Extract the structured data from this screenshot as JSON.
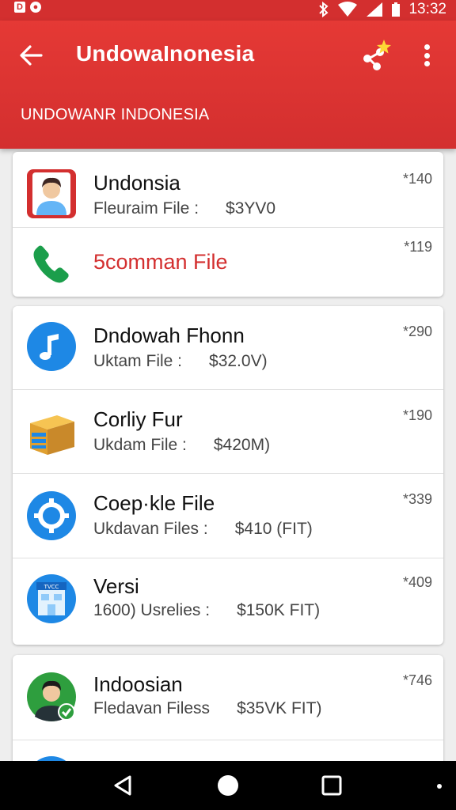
{
  "status_bar": {
    "time": "13:32"
  },
  "app_bar": {
    "title": "UndowaInonesia",
    "subtitle": "UNDOWANR INDONESIA"
  },
  "cards": [
    {
      "rows": [
        {
          "icon": "person-avatar-icon",
          "title": "Undonsia",
          "sub_label": "Fleuraim File :",
          "sub_value": "$3YV0",
          "price": "*140"
        },
        {
          "icon": "phone-icon",
          "title": "5comman File",
          "sub_label": "",
          "sub_value": "",
          "price": "*119",
          "accent": "#d32f2f"
        }
      ]
    },
    {
      "rows": [
        {
          "icon": "music-note-icon",
          "title": "Dndowah Fhonn",
          "sub_label": "Uktam File :",
          "sub_value": "$32.0V)",
          "price": "*290"
        },
        {
          "icon": "package-box-icon",
          "title": "Corliy Fur",
          "sub_label": "Ukdam File :",
          "sub_value": "$420M)",
          "price": "*190"
        },
        {
          "icon": "settings-gear-icon",
          "title": "Coep·kle File",
          "sub_label": "Ukdavan Files :",
          "sub_value": "$410 (FIT)",
          "price": "*339"
        },
        {
          "icon": "store-building-icon",
          "title": "Versi",
          "sub_label": "1600) Usrelies :",
          "sub_value": "$150K FIT)",
          "price": "*409"
        }
      ]
    },
    {
      "rows": [
        {
          "icon": "verified-user-avatar-icon",
          "title": "Indoosian",
          "sub_label": "Fledavan Filess",
          "sub_value": "$35VK FIT)",
          "price": "*746"
        }
      ]
    }
  ],
  "colors": {
    "primary": "#d32f2f",
    "blue": "#1e88e5",
    "green": "#2e7d32"
  }
}
